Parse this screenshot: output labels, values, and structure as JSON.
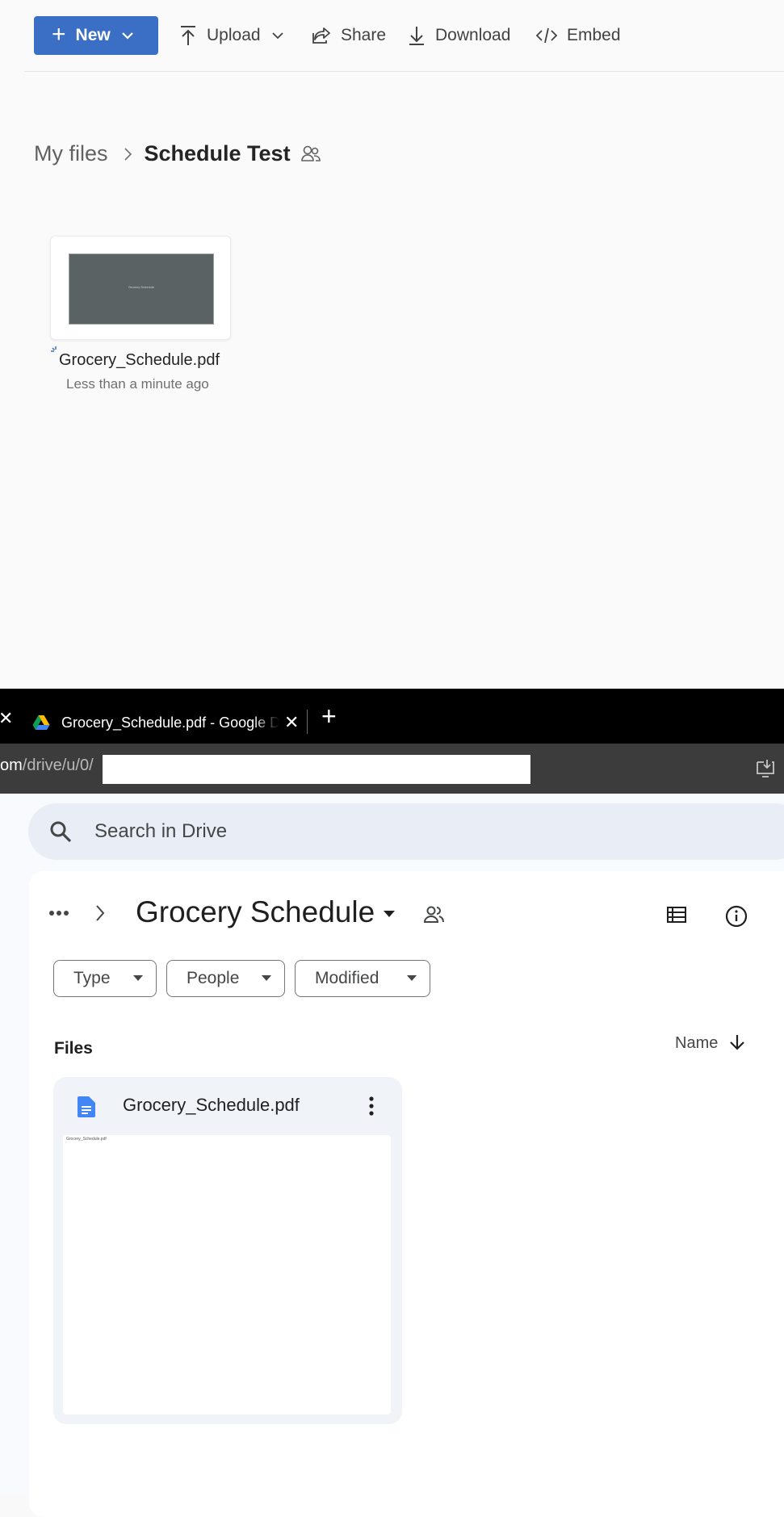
{
  "onedrive": {
    "toolbar": {
      "new_label": "New",
      "upload_label": "Upload",
      "share_label": "Share",
      "download_label": "Download",
      "embed_label": "Embed"
    },
    "breadcrumb": {
      "root": "My files",
      "current": "Schedule Test"
    },
    "file": {
      "name": "Grocery_Schedule.pdf",
      "modified": "Less than a minute ago",
      "thumb_text": "Grocery Schedule"
    }
  },
  "browser": {
    "tab_title": "Grocery_Schedule.pdf - Google Drive",
    "url_domain": "om",
    "url_path": "/drive/u/0/"
  },
  "drive": {
    "search_placeholder": "Search in Drive",
    "folder_title": "Grocery Schedule",
    "filters": [
      "Type",
      "People",
      "Modified"
    ],
    "section_title": "Files",
    "sort_label": "Name",
    "file": {
      "name": "Grocery_Schedule.pdf",
      "preview_text": "Grocery_Schedule.pdf"
    }
  },
  "colors": {
    "new_button": "#3b6fc5",
    "drive_doc_icon": "#4285f4",
    "drive_bg": "#f8fafd"
  }
}
